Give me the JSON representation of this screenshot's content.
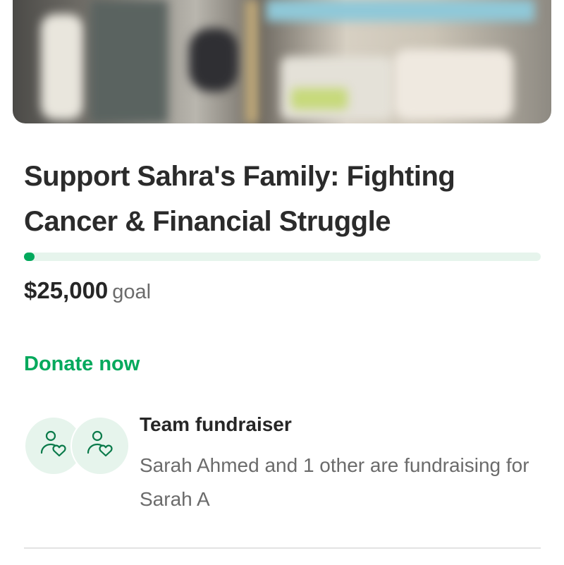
{
  "campaign": {
    "title": "Support Sahra's Family: Fighting Cancer & Financial Struggle",
    "goal_amount": "$25,000",
    "goal_label": "goal",
    "progress_fraction": 0.02,
    "donate_label": "Donate now"
  },
  "team": {
    "title": "Team fundraiser",
    "description": "Sarah Ahmed and 1 other are fundraising for Sarah A",
    "avatar_icons": [
      "person-heart-icon",
      "person-heart-icon"
    ]
  },
  "colors": {
    "accent": "#02a95c",
    "progress_track": "#e6f4ec",
    "avatar_bg": "#e6f4ec",
    "text_primary": "#262626",
    "text_secondary": "#6b6b6b"
  }
}
